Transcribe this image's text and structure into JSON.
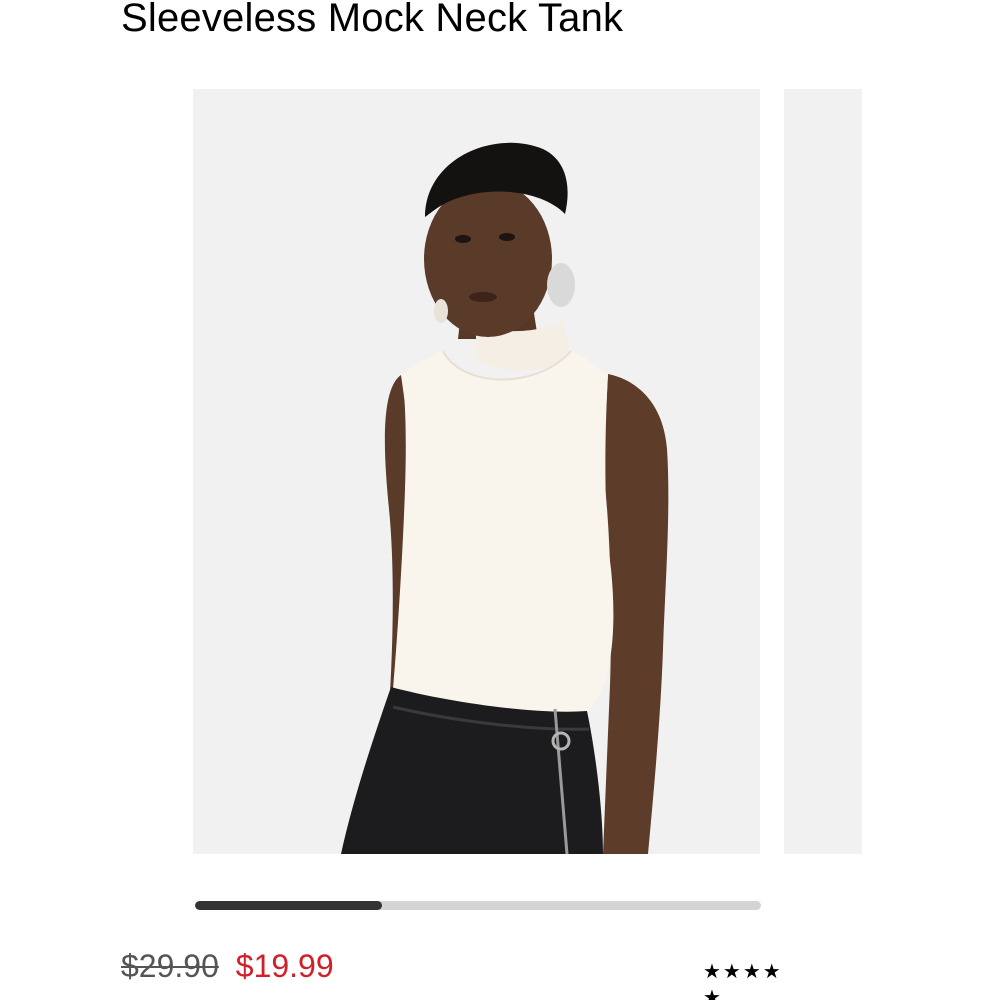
{
  "product": {
    "title": "Sleeveless Mock Neck Tank",
    "price_original": "$29.90",
    "price_sale": "$19.99",
    "rating_stars_row1": "★★★★",
    "rating_stars_row2": "★",
    "rating_value": 5,
    "rating_icon": "star-icon"
  },
  "carousel": {
    "image_subject": "model wearing sleeveless mock neck tank",
    "progress": 0.33
  },
  "colors": {
    "sale_price": "#d0202a",
    "progress_fill": "#333333",
    "progress_track": "#d4d4d4",
    "image_background": "#f1f1f1"
  }
}
